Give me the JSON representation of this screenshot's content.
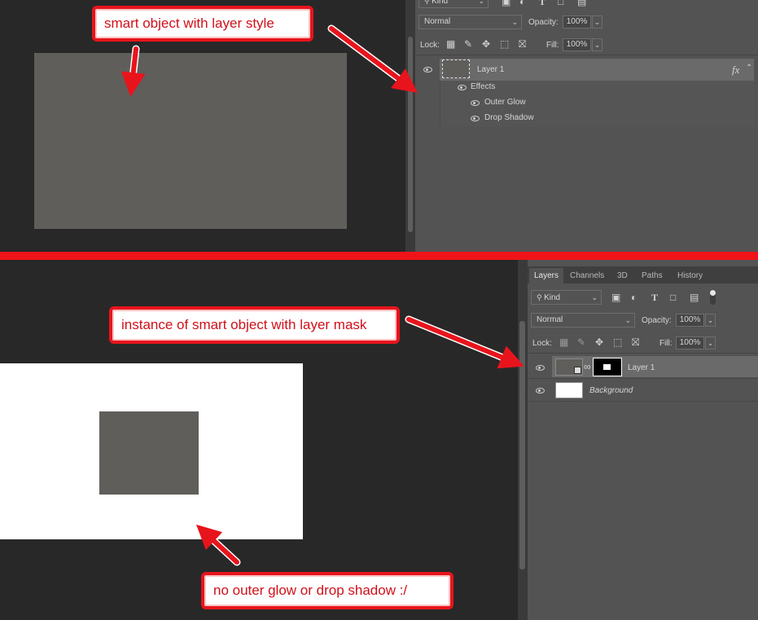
{
  "annotations": {
    "top_callout": "smart object with layer style",
    "middle_callout": "instance of smart object with layer mask",
    "bottom_callout": "no outer glow or drop shadow :/"
  },
  "top_panel": {
    "filter_kind": "Kind",
    "blend_mode": "Normal",
    "opacity_label": "Opacity:",
    "opacity_value": "100%",
    "lock_label": "Lock:",
    "fill_label": "Fill:",
    "fill_value": "100%",
    "layer_name": "Layer 1",
    "fx_badge": "fx",
    "effects_label": "Effects",
    "effects": [
      "Outer Glow",
      "Drop Shadow"
    ]
  },
  "bottom_panel": {
    "tabs": [
      "Layers",
      "Channels",
      "3D",
      "Paths",
      "History"
    ],
    "filter_kind": "Kind",
    "blend_mode": "Normal",
    "opacity_label": "Opacity:",
    "opacity_value": "100%",
    "lock_label": "Lock:",
    "fill_label": "Fill:",
    "fill_value": "100%",
    "layers": [
      "Layer 1",
      "Background"
    ]
  },
  "colors": {
    "canvas_bg": "#282828",
    "panel_bg": "#535353",
    "annotation_red": "#e8141c",
    "smart_object_gray": "#5f5e5b"
  },
  "icons": [
    "search-icon",
    "image-icon",
    "adjust-icon",
    "type-icon",
    "transform-icon",
    "smart-object-icon",
    "eye-icon",
    "lock-transparency-icon",
    "brush-icon",
    "move-icon",
    "artboard-icon",
    "lock-icon",
    "chain-link-icon",
    "chevron-down-icon"
  ]
}
